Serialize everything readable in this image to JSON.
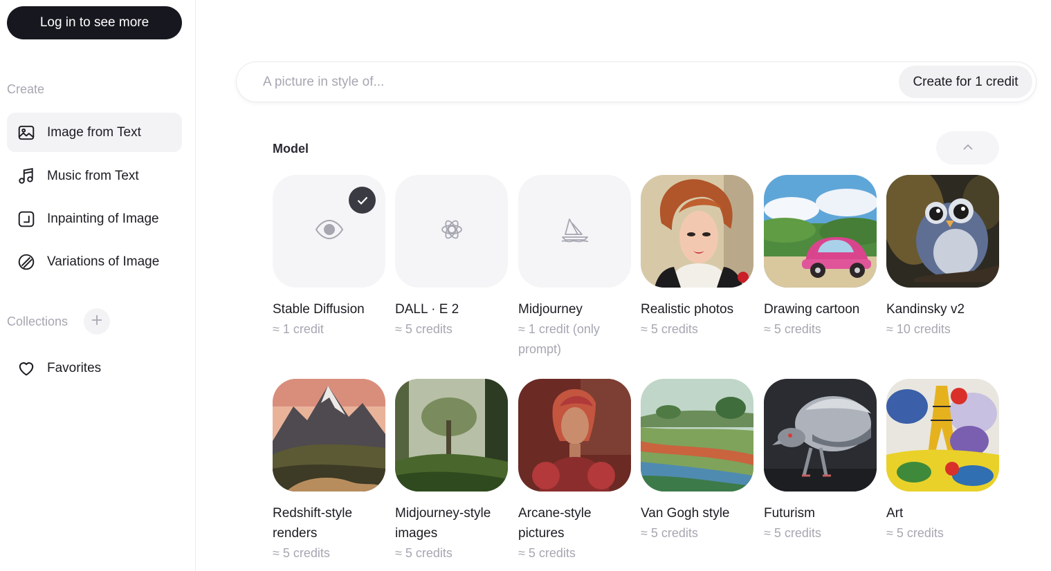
{
  "sidebar": {
    "login_label": "Log in to see more",
    "create_label": "Create",
    "items": [
      {
        "label": "Image from Text",
        "icon": "image-icon",
        "active": true
      },
      {
        "label": "Music from Text",
        "icon": "music-note-icon"
      },
      {
        "label": "Inpainting of Image",
        "icon": "inpainting-icon"
      },
      {
        "label": "Variations of Image",
        "icon": "variations-icon"
      }
    ],
    "collections_label": "Collections",
    "favorites_label": "Favorites"
  },
  "prompt": {
    "placeholder": "A picture in style of...",
    "value": "",
    "create_label": "Create for 1 credit"
  },
  "models": {
    "title": "Model",
    "selected": "Stable Diffusion",
    "items": [
      {
        "name": "Stable Diffusion",
        "cost": "≈ 1 credit",
        "icon": "eye-icon",
        "selected": true
      },
      {
        "name": "DALL · E 2",
        "cost": "≈ 5 credits",
        "icon": "openai-icon"
      },
      {
        "name": "Midjourney",
        "cost": "≈ 1 credit (only prompt)",
        "icon": "sailboat-icon"
      },
      {
        "name": "Realistic photos",
        "cost": "≈ 5 credits",
        "icon": "portrait-thumbnail"
      },
      {
        "name": "Drawing cartoon",
        "cost": "≈ 5 credits",
        "icon": "car-thumbnail"
      },
      {
        "name": "Kandinsky v2",
        "cost": "≈ 10 credits",
        "icon": "owl-thumbnail"
      },
      {
        "name": "Redshift-style renders",
        "cost": "≈ 5 credits",
        "icon": "mountain-thumbnail"
      },
      {
        "name": "Midjourney-style images",
        "cost": "≈ 5 credits",
        "icon": "forest-thumbnail"
      },
      {
        "name": "Arcane-style pictures",
        "cost": "≈ 5 credits",
        "icon": "arcane-thumbnail"
      },
      {
        "name": "Van Gogh style",
        "cost": "≈ 5 credits",
        "icon": "field-thumbnail"
      },
      {
        "name": "Futurism",
        "cost": "≈ 5 credits",
        "icon": "robot-bird-thumbnail"
      },
      {
        "name": "Art",
        "cost": "≈ 5 credits",
        "icon": "eiffel-art-thumbnail"
      }
    ]
  },
  "colors": {
    "accent_dark": "#17181f",
    "muted_text": "#a6a7b1",
    "panel_bg": "#f3f3f5"
  }
}
